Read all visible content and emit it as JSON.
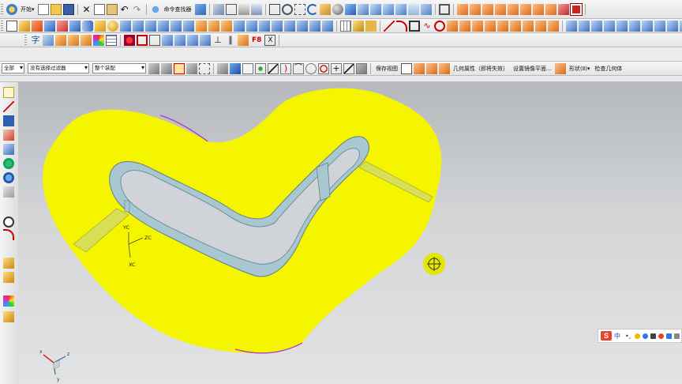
{
  "menu_bar": {
    "start_label": "开始▾",
    "command_finder_label": "命令查找器"
  },
  "selection_bar": {
    "filter_value": "全部",
    "snap_value": "没有选择过滤器",
    "assembly_value": "整个装配",
    "save_view_label": "保存视图",
    "geometry_props_label": "几何属性（即将失效）",
    "mirror_plane_label": "设置镜像平面…",
    "shape_label": "形状(Ⅱ)▾",
    "check_geometry_label": "检查几何体"
  },
  "toolbar_row3": {
    "f8_label": "F8"
  },
  "viewport": {
    "triad_labels": {
      "yc": "YC",
      "zc": "ZC",
      "xc": "XC"
    },
    "mini_triad_labels": {
      "x": "x",
      "y": "y",
      "z": "z"
    },
    "part_color": "#f5f500",
    "frame_color": "#a9c7d1",
    "edge_color": "#b030c0"
  },
  "ime_bar": {
    "logo": "S",
    "mode": "中",
    "punct": "•,"
  },
  "colors": {
    "toolbar_bg": "#ececec",
    "viewport_top": "#b5b8bc",
    "viewport_bottom": "#e2e3e4"
  }
}
